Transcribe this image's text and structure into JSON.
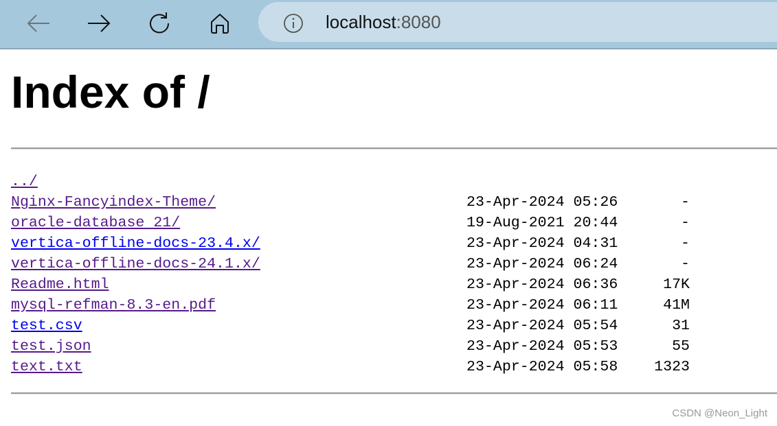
{
  "browser": {
    "url_host": "localhost",
    "url_port": ":8080",
    "icons": [
      "back-arrow-icon",
      "forward-arrow-icon",
      "reload-icon",
      "home-icon",
      "info-icon"
    ]
  },
  "page": {
    "title": "Index of /",
    "entries": [
      {
        "name": "../",
        "date": "",
        "size": "",
        "visited": true
      },
      {
        "name": "Nginx-Fancyindex-Theme/",
        "date": "23-Apr-2024 05:26",
        "size": "-",
        "visited": true
      },
      {
        "name": "oracle-database 21/",
        "date": "19-Aug-2021 20:44",
        "size": "-",
        "visited": true
      },
      {
        "name": "vertica-offline-docs-23.4.x/",
        "date": "23-Apr-2024 04:31",
        "size": "-",
        "visited": false
      },
      {
        "name": "vertica-offline-docs-24.1.x/",
        "date": "23-Apr-2024 06:24",
        "size": "-",
        "visited": true
      },
      {
        "name": "Readme.html",
        "date": "23-Apr-2024 06:36",
        "size": "17K",
        "visited": true
      },
      {
        "name": "mysql-refman-8.3-en.pdf",
        "date": "23-Apr-2024 06:11",
        "size": "41M",
        "visited": true
      },
      {
        "name": "test.csv",
        "date": "23-Apr-2024 05:54",
        "size": "31",
        "visited": false
      },
      {
        "name": "test.json",
        "date": "23-Apr-2024 05:53",
        "size": "55",
        "visited": true
      },
      {
        "name": "text.txt",
        "date": "23-Apr-2024 05:58",
        "size": "1323",
        "visited": true
      }
    ]
  },
  "watermark": "CSDN @Neon_Light",
  "colors": {
    "link": "#0000ee",
    "visited": "#551a8b",
    "toolbar": "#a6c8dc",
    "addressbar": "#c8dde9"
  }
}
